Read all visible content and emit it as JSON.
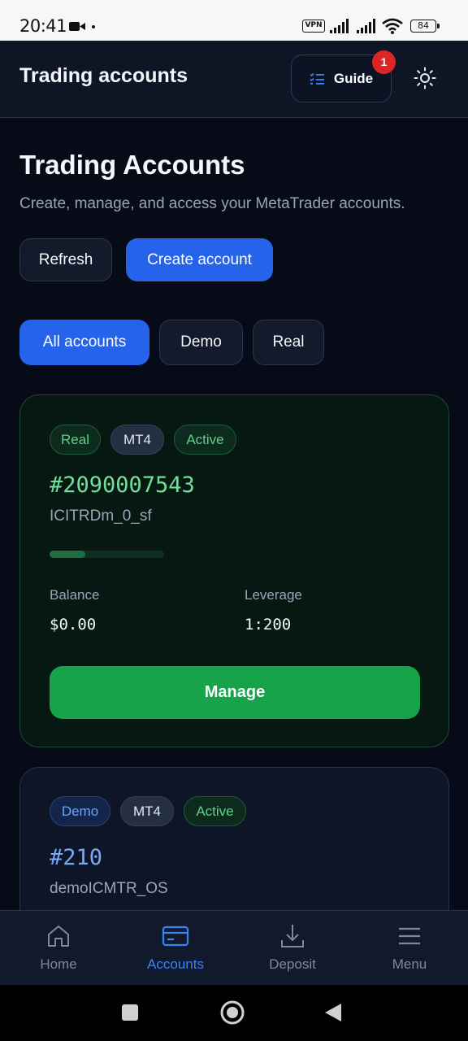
{
  "status_bar": {
    "time": "20:41",
    "vpn": "VPN",
    "battery": "84"
  },
  "header": {
    "title": "Trading accounts",
    "guide_label": "Guide",
    "guide_badge": "1"
  },
  "page": {
    "title": "Trading Accounts",
    "subtitle": "Create, manage, and access your MetaTrader accounts.",
    "refresh_label": "Refresh",
    "create_label": "Create account"
  },
  "filters": {
    "tabs": [
      "All accounts",
      "Demo",
      "Real"
    ],
    "selected": "All accounts"
  },
  "accounts": [
    {
      "type": "Real",
      "platform": "MT4",
      "status": "Active",
      "number": "#2090007543",
      "server": "ICITRDm_0_sf",
      "progress": 0.31,
      "balance_label": "Balance",
      "balance": "$0.00",
      "leverage_label": "Leverage",
      "leverage": "1:200",
      "action_label": "Manage"
    },
    {
      "type": "Demo",
      "platform": "MT4",
      "status": "Active",
      "number": "#210",
      "server": "demoICMTR_OS"
    }
  ],
  "bottom_nav": {
    "items": [
      "Home",
      "Accounts",
      "Deposit",
      "Menu"
    ],
    "active": "Accounts"
  },
  "colors": {
    "accent_blue": "#2563eb",
    "success_green": "#16a34a",
    "badge_red": "#dc2626",
    "background": "#060b17"
  }
}
